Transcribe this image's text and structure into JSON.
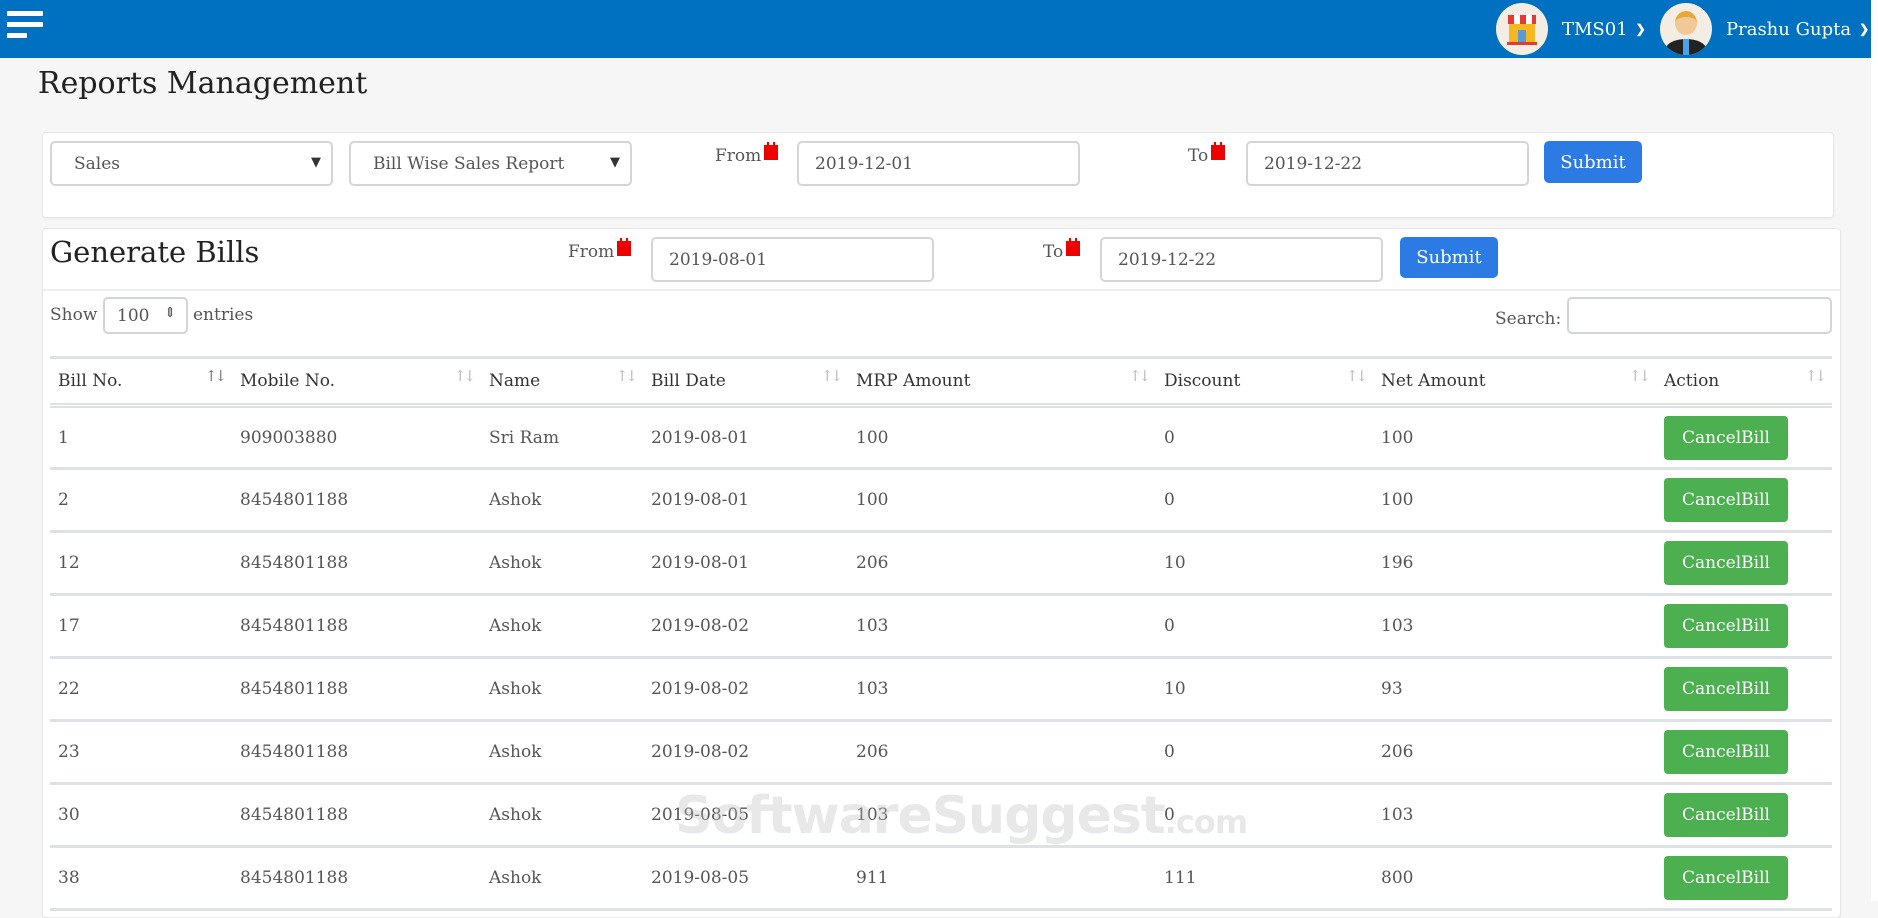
{
  "header": {
    "store": "TMS01",
    "user": "Prashu Gupta"
  },
  "page_title": "Reports Management",
  "filters": {
    "category": "Sales",
    "report": "Bill Wise Sales Report",
    "from_label": "From",
    "from": "2019-12-01",
    "to_label": "To",
    "to": "2019-12-22",
    "submit": "Submit"
  },
  "bills": {
    "title": "Generate Bills",
    "from_label": "From",
    "from": "2019-08-01",
    "to_label": "To",
    "to": "2019-12-22",
    "submit": "Submit",
    "show_label": "Show",
    "entries_value": "100",
    "entries_label": "entries",
    "search_label": "Search:",
    "search_value": "",
    "columns": [
      "Bill No.",
      "Mobile No.",
      "Name",
      "Bill Date",
      "MRP Amount",
      "Discount",
      "Net Amount",
      "Action"
    ],
    "rows": [
      [
        "1",
        "909003880",
        "Sri Ram",
        "2019-08-01",
        "100",
        "0",
        "100"
      ],
      [
        "2",
        "8454801188",
        "Ashok",
        "2019-08-01",
        "100",
        "0",
        "100"
      ],
      [
        "12",
        "8454801188",
        "Ashok",
        "2019-08-01",
        "206",
        "10",
        "196"
      ],
      [
        "17",
        "8454801188",
        "Ashok",
        "2019-08-02",
        "103",
        "0",
        "103"
      ],
      [
        "22",
        "8454801188",
        "Ashok",
        "2019-08-02",
        "103",
        "10",
        "93"
      ],
      [
        "23",
        "8454801188",
        "Ashok",
        "2019-08-02",
        "206",
        "0",
        "206"
      ],
      [
        "30",
        "8454801188",
        "Ashok",
        "2019-08-05",
        "103",
        "0",
        "103"
      ],
      [
        "38",
        "8454801188",
        "Ashok",
        "2019-08-05",
        "911",
        "111",
        "800"
      ]
    ],
    "action_label": "CancelBill"
  },
  "watermark": {
    "main": "SoftwareSuggest",
    "suffix": ".com"
  },
  "colors": {
    "topbar": "#0070c0",
    "primary": "#2c7be5",
    "success": "#4caf50",
    "calendar": "#ee0000"
  }
}
